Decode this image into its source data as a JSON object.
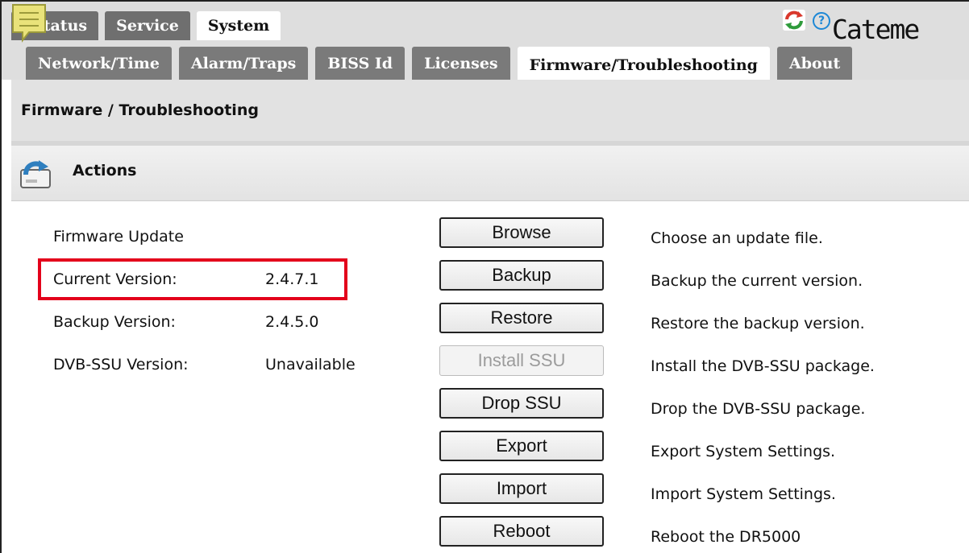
{
  "top_tabs": [
    {
      "label": "Status"
    },
    {
      "label": "Service"
    },
    {
      "label": "System"
    }
  ],
  "sub_tabs": [
    {
      "label": "Network/Time"
    },
    {
      "label": "Alarm/Traps"
    },
    {
      "label": "BISS Id"
    },
    {
      "label": "Licenses"
    },
    {
      "label": "Firmware/Troubleshooting"
    },
    {
      "label": "About"
    }
  ],
  "brand": "ateme",
  "page_title": "Firmware / Troubleshooting",
  "section": {
    "title": "Actions"
  },
  "firmware": {
    "update_label": "Firmware Update",
    "current_label": "Current Version:",
    "current_value": "2.4.7.1",
    "backup_label": "Backup Version:",
    "backup_value": "2.4.5.0",
    "ssu_label": "DVB-SSU Version:",
    "ssu_value": "Unavailable"
  },
  "actions": [
    {
      "button": "Browse",
      "desc": "Choose an update file.",
      "enabled": true
    },
    {
      "button": "Backup",
      "desc": "Backup the current version.",
      "enabled": true
    },
    {
      "button": "Restore",
      "desc": "Restore the backup version.",
      "enabled": true
    },
    {
      "button": "Install SSU",
      "desc": "Install the DVB-SSU package.",
      "enabled": false
    },
    {
      "button": "Drop SSU",
      "desc": "Drop the DVB-SSU package.",
      "enabled": true
    },
    {
      "button": "Export",
      "desc": "Export System Settings.",
      "enabled": true
    },
    {
      "button": "Import",
      "desc": "Import System Settings.",
      "enabled": true
    },
    {
      "button": "Reboot",
      "desc": "Reboot the DR5000",
      "enabled": true
    }
  ],
  "colors": {
    "highlight_box": "#e3001b",
    "tab_bg": "#6f6f6f",
    "help_icon": "#1e88d6"
  }
}
